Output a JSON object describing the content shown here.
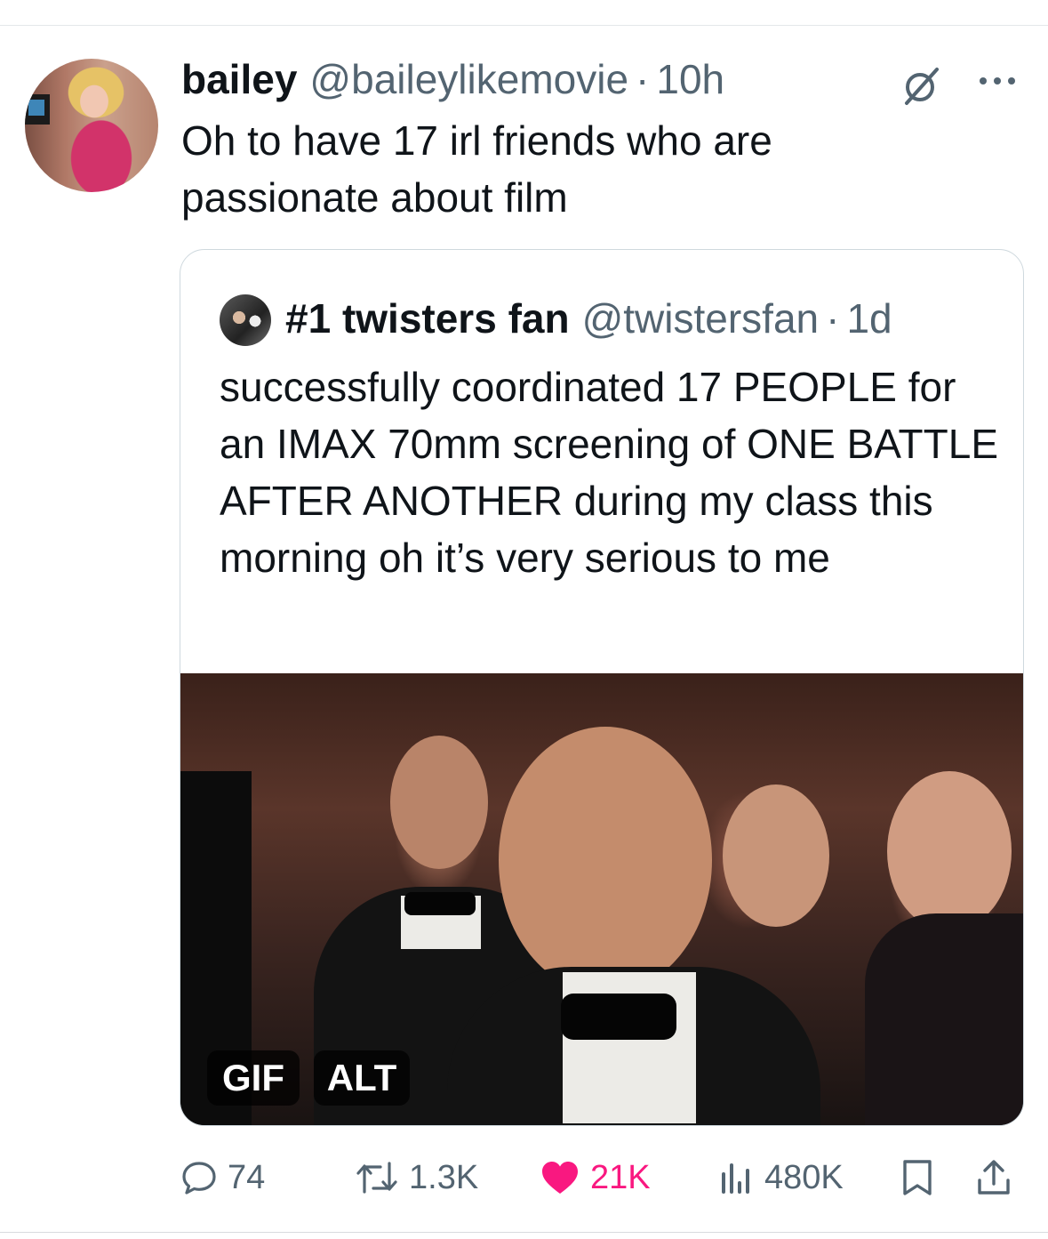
{
  "tweet": {
    "display_name": "bailey",
    "handle": "@baileylikemovie",
    "separator": "·",
    "time": "10h",
    "text": "Oh to have 17 irl friends who are passionate about film"
  },
  "quote": {
    "display_name": "#1 twisters fan",
    "handle": "@twistersfan",
    "separator": "·",
    "time": "1d",
    "text": "successfully coordinated 17 PEOPLE for an IMAX 70mm screening of ONE BATTLE AFTER ANOTHER during my class this morning oh it’s very serious to me",
    "media": {
      "gif_badge": "GIF",
      "alt_badge": "ALT"
    }
  },
  "actions": {
    "replies": "74",
    "reposts": "1.3K",
    "likes": "21K",
    "views": "480K"
  },
  "icons": {
    "grok": "grok-icon",
    "more": "more-icon",
    "reply": "reply-icon",
    "repost": "repost-icon",
    "like": "heart-icon",
    "views": "views-icon",
    "bookmark": "bookmark-icon",
    "share": "share-icon"
  },
  "colors": {
    "text": "#0f1419",
    "secondary": "#536471",
    "like": "#f91880",
    "border": "#cfd9de"
  }
}
